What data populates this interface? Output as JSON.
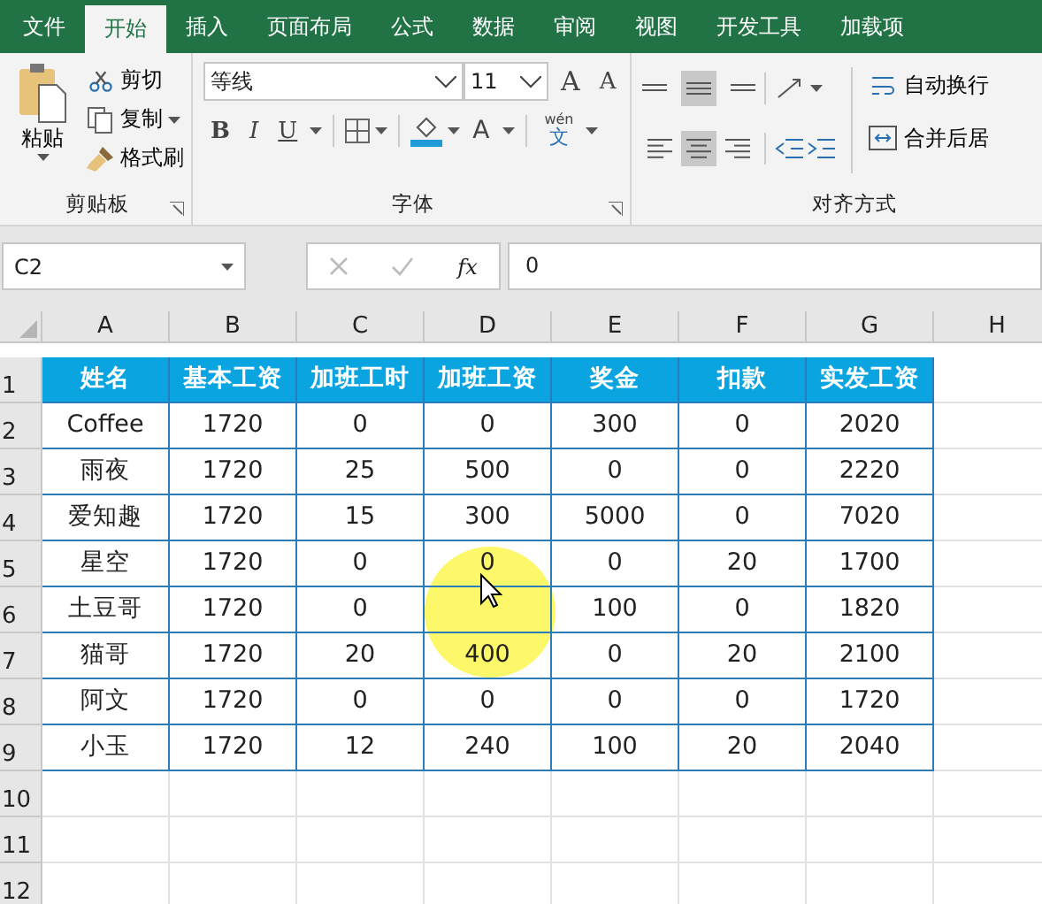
{
  "tabs": [
    {
      "label": "文件",
      "selected": false
    },
    {
      "label": "开始",
      "selected": true
    },
    {
      "label": "插入",
      "selected": false
    },
    {
      "label": "页面布局",
      "selected": false
    },
    {
      "label": "公式",
      "selected": false
    },
    {
      "label": "数据",
      "selected": false
    },
    {
      "label": "审阅",
      "selected": false
    },
    {
      "label": "视图",
      "selected": false
    },
    {
      "label": "开发工具",
      "selected": false
    },
    {
      "label": "加载项",
      "selected": false
    }
  ],
  "clipboard": {
    "paste": "粘贴",
    "cut": "剪切",
    "copy": "复制",
    "format_painter": "格式刷",
    "label": "剪贴板"
  },
  "font": {
    "name": "等线",
    "size": "11",
    "grow": "A",
    "shrink": "A",
    "styles": [
      "B",
      "I",
      "U"
    ],
    "color_letter": "A",
    "phonetic": "wén",
    "phonetic_char": "文",
    "label": "字体"
  },
  "alignment": {
    "vertical": [
      {
        "selected": false
      },
      {
        "selected": true
      },
      {
        "selected": false
      }
    ],
    "horizontal": [
      {
        "selected": false
      },
      {
        "selected": true
      },
      {
        "selected": false
      }
    ],
    "wrap": "自动换行",
    "merge": "合并后居",
    "label": "对齐方式"
  },
  "formula_bar": {
    "name_box": "C2",
    "fx": "fx",
    "value": "0"
  },
  "sheet": {
    "columns": [
      "A",
      "B",
      "C",
      "D",
      "E",
      "F",
      "G",
      "H"
    ],
    "row_numbers": [
      "1",
      "2",
      "3",
      "4",
      "5",
      "6",
      "7",
      "8",
      "9",
      "10",
      "11",
      "12"
    ],
    "header": [
      "姓名",
      "基本工资",
      "加班工时",
      "加班工资",
      "奖金",
      "扣款",
      "实发工资"
    ],
    "rows": [
      [
        "Coffee",
        "1720",
        "0",
        "0",
        "300",
        "0",
        "2020"
      ],
      [
        "雨夜",
        "1720",
        "25",
        "500",
        "0",
        "0",
        "2220"
      ],
      [
        "爱知趣",
        "1720",
        "15",
        "300",
        "5000",
        "0",
        "7020"
      ],
      [
        "星空",
        "1720",
        "0",
        "0",
        "0",
        "20",
        "1700"
      ],
      [
        "土豆哥",
        "1720",
        "0",
        null,
        "100",
        "0",
        "1820"
      ],
      [
        "猫哥",
        "1720",
        "20",
        "400",
        "0",
        "20",
        "2100"
      ],
      [
        "阿文",
        "1720",
        "0",
        "0",
        "0",
        "0",
        "1720"
      ],
      [
        "小玉",
        "1720",
        "12",
        "240",
        "100",
        "20",
        "2040"
      ]
    ]
  }
}
